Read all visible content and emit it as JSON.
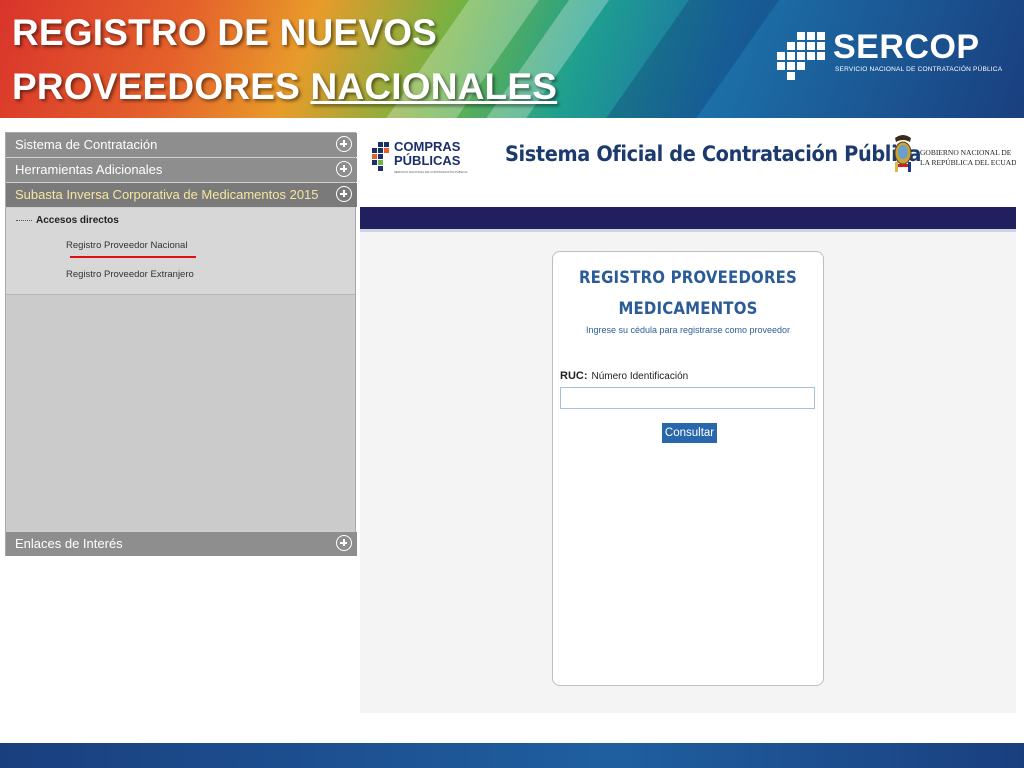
{
  "slide": {
    "title_line1": "REGISTRO DE NUEVOS",
    "title_line2_plain": "PROVEEDORES ",
    "title_line2_underlined": "NACIONALES"
  },
  "sercop_logo": {
    "name": "SERCOP",
    "subtitle": "SERVICIO NACIONAL DE CONTRATACIÓN PÚBLICA",
    "icon": "pixel-logo-icon"
  },
  "sidebar": {
    "sections": [
      {
        "label": "Sistema de Contratación",
        "icon": "plus-circle-icon"
      },
      {
        "label": "Herramientas Adicionales",
        "icon": "plus-circle-icon"
      },
      {
        "label": "Subasta Inversa Corporativa de Medicamentos 2015",
        "icon": "plus-circle-icon",
        "active": true
      }
    ],
    "accesos_header": "Accesos directos",
    "links": [
      "Registro Proveedor Nacional",
      "Registro Proveedor Extranjero"
    ],
    "footer_section": "Enlaces de Interés"
  },
  "portal": {
    "compras_logo_line1": "COMPRAS",
    "compras_logo_line2": "PÚBLICAS",
    "compras_logo_small": "SERVICIO NACIONAL DE CONTRATACIÓN PÚBLICA",
    "system_title": "Sistema Oficial de Contratación Pública",
    "gov_line1": "GOBIERNO NACIONAL DE",
    "gov_line2": "LA REPÚBLICA DEL ECUADOR",
    "navbar_color": "#221f5e"
  },
  "form": {
    "title_line1": "REGISTRO PROVEEDORES",
    "title_line2": "MEDICAMENTOS",
    "subtitle": "Ingrese su cédula para registrarse como proveedor",
    "ruc_label": "RUC:",
    "id_label": "Número Identificación",
    "ruc_value": "",
    "consult_button": "Consultar"
  },
  "colors": {
    "accent_blue": "#2867ab",
    "title_blue": "#2b5c97",
    "sidebar_header": "#8e8e8e",
    "active_text": "#f5e7a0",
    "underline_red": "#dd1111"
  }
}
